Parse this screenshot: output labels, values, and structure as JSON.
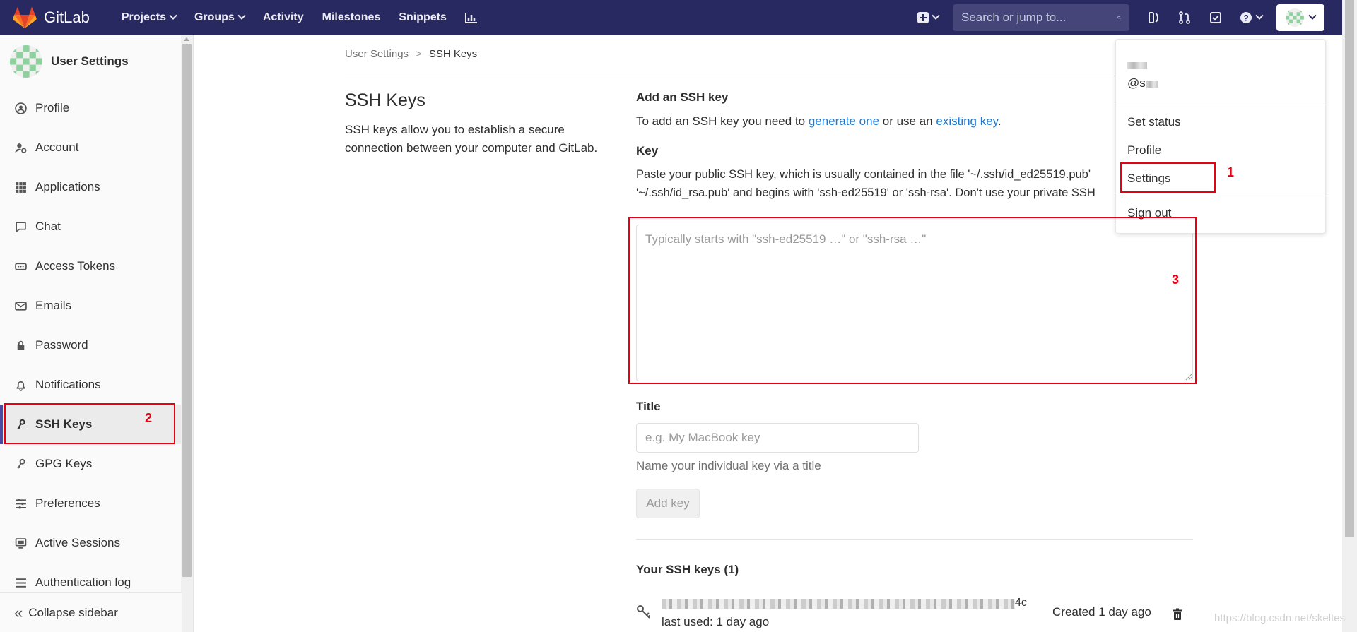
{
  "navbar": {
    "brand": "GitLab",
    "links": [
      {
        "label": "Projects",
        "caret": true
      },
      {
        "label": "Groups",
        "caret": true
      },
      {
        "label": "Activity",
        "caret": false
      },
      {
        "label": "Milestones",
        "caret": false
      },
      {
        "label": "Snippets",
        "caret": false
      }
    ],
    "search_placeholder": "Search or jump to...",
    "colors": {
      "bg": "#292961",
      "search_bg": "#45457a"
    }
  },
  "sidebar": {
    "title": "User Settings",
    "items": [
      {
        "label": "Profile",
        "icon": "profile-icon"
      },
      {
        "label": "Account",
        "icon": "account-icon"
      },
      {
        "label": "Applications",
        "icon": "applications-icon"
      },
      {
        "label": "Chat",
        "icon": "chat-icon"
      },
      {
        "label": "Access Tokens",
        "icon": "token-icon"
      },
      {
        "label": "Emails",
        "icon": "email-icon"
      },
      {
        "label": "Password",
        "icon": "lock-icon"
      },
      {
        "label": "Notifications",
        "icon": "bell-icon"
      },
      {
        "label": "SSH Keys",
        "icon": "key-icon",
        "active": true
      },
      {
        "label": "GPG Keys",
        "icon": "key-icon"
      },
      {
        "label": "Preferences",
        "icon": "sliders-icon"
      },
      {
        "label": "Active Sessions",
        "icon": "monitor-icon"
      },
      {
        "label": "Authentication log",
        "icon": "list-icon"
      }
    ],
    "collapse_label": "Collapse sidebar"
  },
  "breadcrumb": {
    "parent": "User Settings",
    "sep": ">",
    "current": "SSH Keys"
  },
  "left": {
    "heading": "SSH Keys",
    "description": "SSH keys allow you to establish a secure connection between your computer and GitLab."
  },
  "form": {
    "heading": "Add an SSH key",
    "intro_prefix": "To add an SSH key you need to ",
    "intro_link1": "generate one",
    "intro_middle": " or use an ",
    "intro_link2": "existing key",
    "intro_suffix": ".",
    "key_label": "Key",
    "key_help_line1": "Paste your public SSH key, which is usually contained in the file '~/.ssh/id_ed25519.pub'",
    "key_help_line2": "'~/.ssh/id_rsa.pub' and begins with 'ssh-ed25519' or 'ssh-rsa'. Don't use your private SSH",
    "key_placeholder": "Typically starts with \"ssh-ed25519 …\" or \"ssh-rsa …\"",
    "title_label": "Title",
    "title_placeholder": "e.g. My MacBook key",
    "title_help": "Name your individual key via a title",
    "add_button": "Add key"
  },
  "keys": {
    "heading": "Your SSH keys (1)",
    "items": [
      {
        "fingerprint_suffix": "4c",
        "last_used": "last used: 1 day ago",
        "created": "Created 1 day ago"
      }
    ]
  },
  "dropdown": {
    "username_suffix": "@s",
    "items_top": [
      "Set status",
      "Profile",
      "Settings"
    ],
    "sign_out": "Sign out"
  },
  "annotations": {
    "n1": "1",
    "n2": "2",
    "n3": "3",
    "color": "#e60012"
  },
  "watermark": "https://blog.csdn.net/skeltes"
}
